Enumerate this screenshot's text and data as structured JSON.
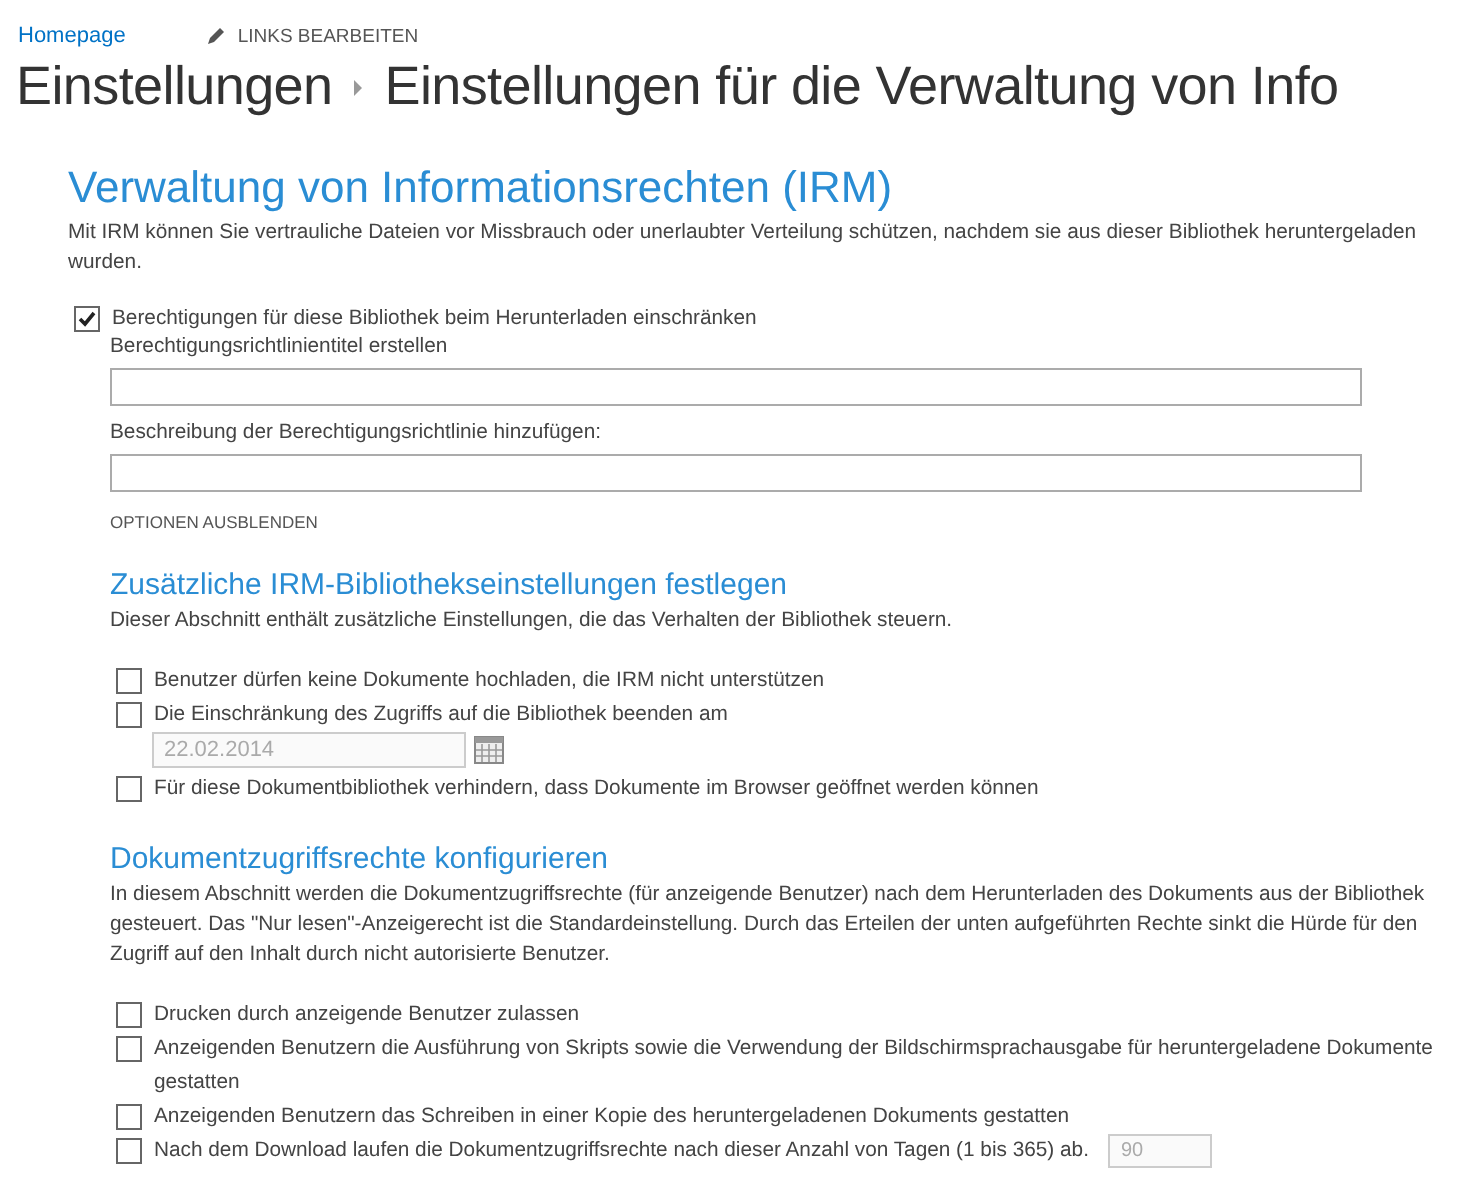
{
  "top_links": {
    "home": "Homepage",
    "edit": "LINKS BEARBEITEN"
  },
  "breadcrumb": [
    "Einstellungen",
    "Einstellungen für die Verwaltung von Info"
  ],
  "irm": {
    "heading": "Verwaltung von Informationsrechten (IRM)",
    "description": "Mit IRM können Sie vertrauliche Dateien vor Missbrauch oder unerlaubter Verteilung schützen, nachdem sie aus dieser Bibliothek heruntergeladen wurden.",
    "restrict": {
      "label": "Berechtigungen für diese Bibliothek beim Herunterladen einschränken",
      "checked": true
    },
    "fields": [
      {
        "label": "Berechtigungsrichtlinientitel erstellen"
      },
      {
        "label": "Beschreibung der Berechtigungsrichtlinie hinzufügen:"
      }
    ],
    "toggle_options": "OPTIONEN AUSBLENDEN"
  },
  "sections": [
    {
      "heading": "Zusätzliche IRM-Bibliothekseinstellungen festlegen",
      "description": "Dieser Abschnitt enthält zusätzliche Einstellungen, die das Verhalten der Bibliothek steuern.",
      "options": [
        {
          "kind": "plain",
          "label": "Benutzer dürfen keine Dokumente hochladen, die IRM nicht unterstützen",
          "checked": false
        },
        {
          "kind": "date",
          "label": "Die Einschränkung des Zugriffs auf die Bibliothek beenden am",
          "checked": false,
          "value": "22.02.2014",
          "disabled": true
        },
        {
          "kind": "plain",
          "label": "Für diese Dokumentbibliothek verhindern, dass Dokumente im Browser geöffnet werden können",
          "checked": false
        }
      ]
    },
    {
      "heading": "Dokumentzugriffsrechte konfigurieren",
      "description": "In diesem Abschnitt werden die Dokumentzugriffsrechte (für anzeigende Benutzer) nach dem Herunterladen des Dokuments aus der Bibliothek gesteuert. Das \"Nur lesen\"-Anzeigerecht ist die Standardeinstellung. Durch das Erteilen der unten aufgeführten Rechte sinkt die Hürde für den Zugriff auf den Inhalt durch nicht autorisierte Benutzer.",
      "options": [
        {
          "kind": "plain",
          "label": "Drucken durch anzeigende Benutzer zulassen",
          "checked": false
        },
        {
          "kind": "plain",
          "label": "Anzeigenden Benutzern die Ausführung von Skripts sowie die Verwendung der Bildschirmsprachausgabe für heruntergeladene Dokumente gestatten",
          "checked": false
        },
        {
          "kind": "plain",
          "label": "Anzeigenden Benutzern das Schreiben in einer Kopie des heruntergeladenen Dokuments gestatten",
          "checked": false
        },
        {
          "kind": "number",
          "label": "Nach dem Download laufen die Dokumentzugriffsrechte nach dieser Anzahl von Tagen (1 bis 365) ab.",
          "checked": false,
          "value": "90",
          "disabled": true
        }
      ]
    }
  ]
}
